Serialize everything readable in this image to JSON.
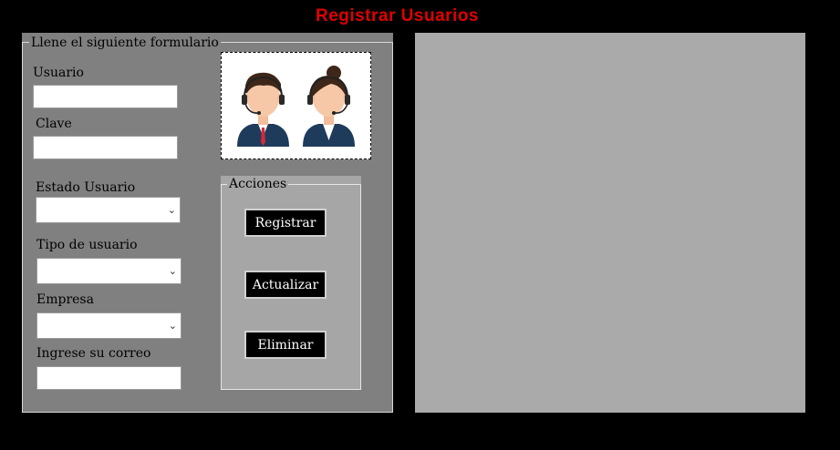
{
  "window": {
    "title": "Registrar  Usuarios"
  },
  "form": {
    "legend": "Llene el siguiente formulario",
    "usuario_label": "Usuario",
    "usuario_value": "",
    "clave_label": "Clave",
    "clave_value": "",
    "estado_label": "Estado Usuario",
    "estado_value": "",
    "tipo_label": "Tipo de usuario",
    "tipo_value": "",
    "empresa_label": "Empresa",
    "empresa_value": "",
    "correo_label": "Ingrese su correo",
    "correo_value": ""
  },
  "image": {
    "icon": "call-center-agents-icon"
  },
  "actions": {
    "legend": "Acciones",
    "register_label": "Registrar",
    "update_label": "Actualizar",
    "delete_label": "Eliminar"
  },
  "colors": {
    "background": "#000000",
    "title": "#e10000",
    "form_panel": "#808080",
    "actions_panel": "#a6a6a6",
    "grid_panel": "#aaaaaa"
  }
}
